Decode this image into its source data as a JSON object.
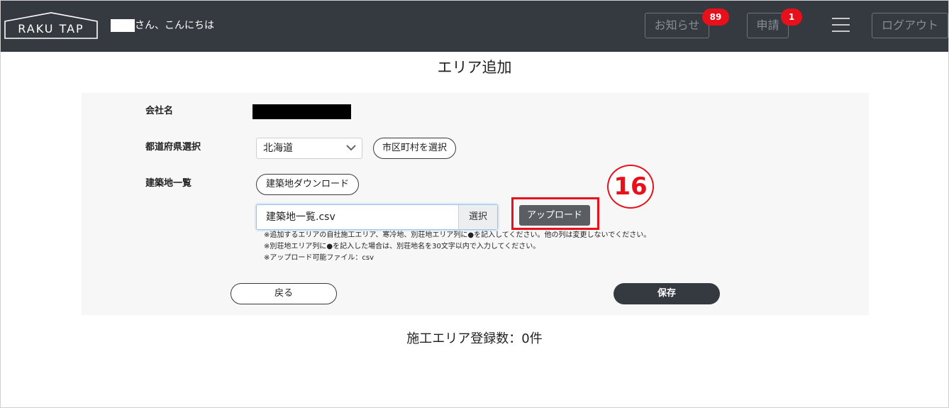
{
  "header": {
    "logo_text": "RAKU TAP",
    "greeting": "さん、こんにちは",
    "news_label": "お知らせ",
    "news_badge": "89",
    "apply_label": "申請",
    "apply_badge": "1",
    "logout_label": "ログアウト"
  },
  "page": {
    "title": "エリア追加"
  },
  "form": {
    "company_label": "会社名",
    "prefecture_label": "都道府県選択",
    "prefecture_selected": "北海道",
    "city_button": "市区町村を選択",
    "site_list_label": "建築地一覧",
    "download_button": "建築地ダウンロード",
    "file_name": "建築地一覧.csv",
    "file_select_button": "選択",
    "upload_button": "アップロード",
    "notes": [
      "※追加するエリアの自社施工エリア、寒冷地、別荘地エリア列に●を記入してください。他の列は変更しないでください。",
      "※別荘地エリア列に●を記入した場合は、別荘地名を30文字以内で入力してください。",
      "※アップロード可能ファイル：csv"
    ],
    "back_button": "戻る",
    "save_button": "保存"
  },
  "annotation": {
    "step_number": "16"
  },
  "summary": {
    "count_text": "施工エリア登録数：0件"
  },
  "colors": {
    "header_bg": "#343a40",
    "badge_red": "#e8101a",
    "annotation_red": "#e8101a",
    "upload_btn_bg": "#5a5e63",
    "panel_bg": "#f7f7f8"
  }
}
